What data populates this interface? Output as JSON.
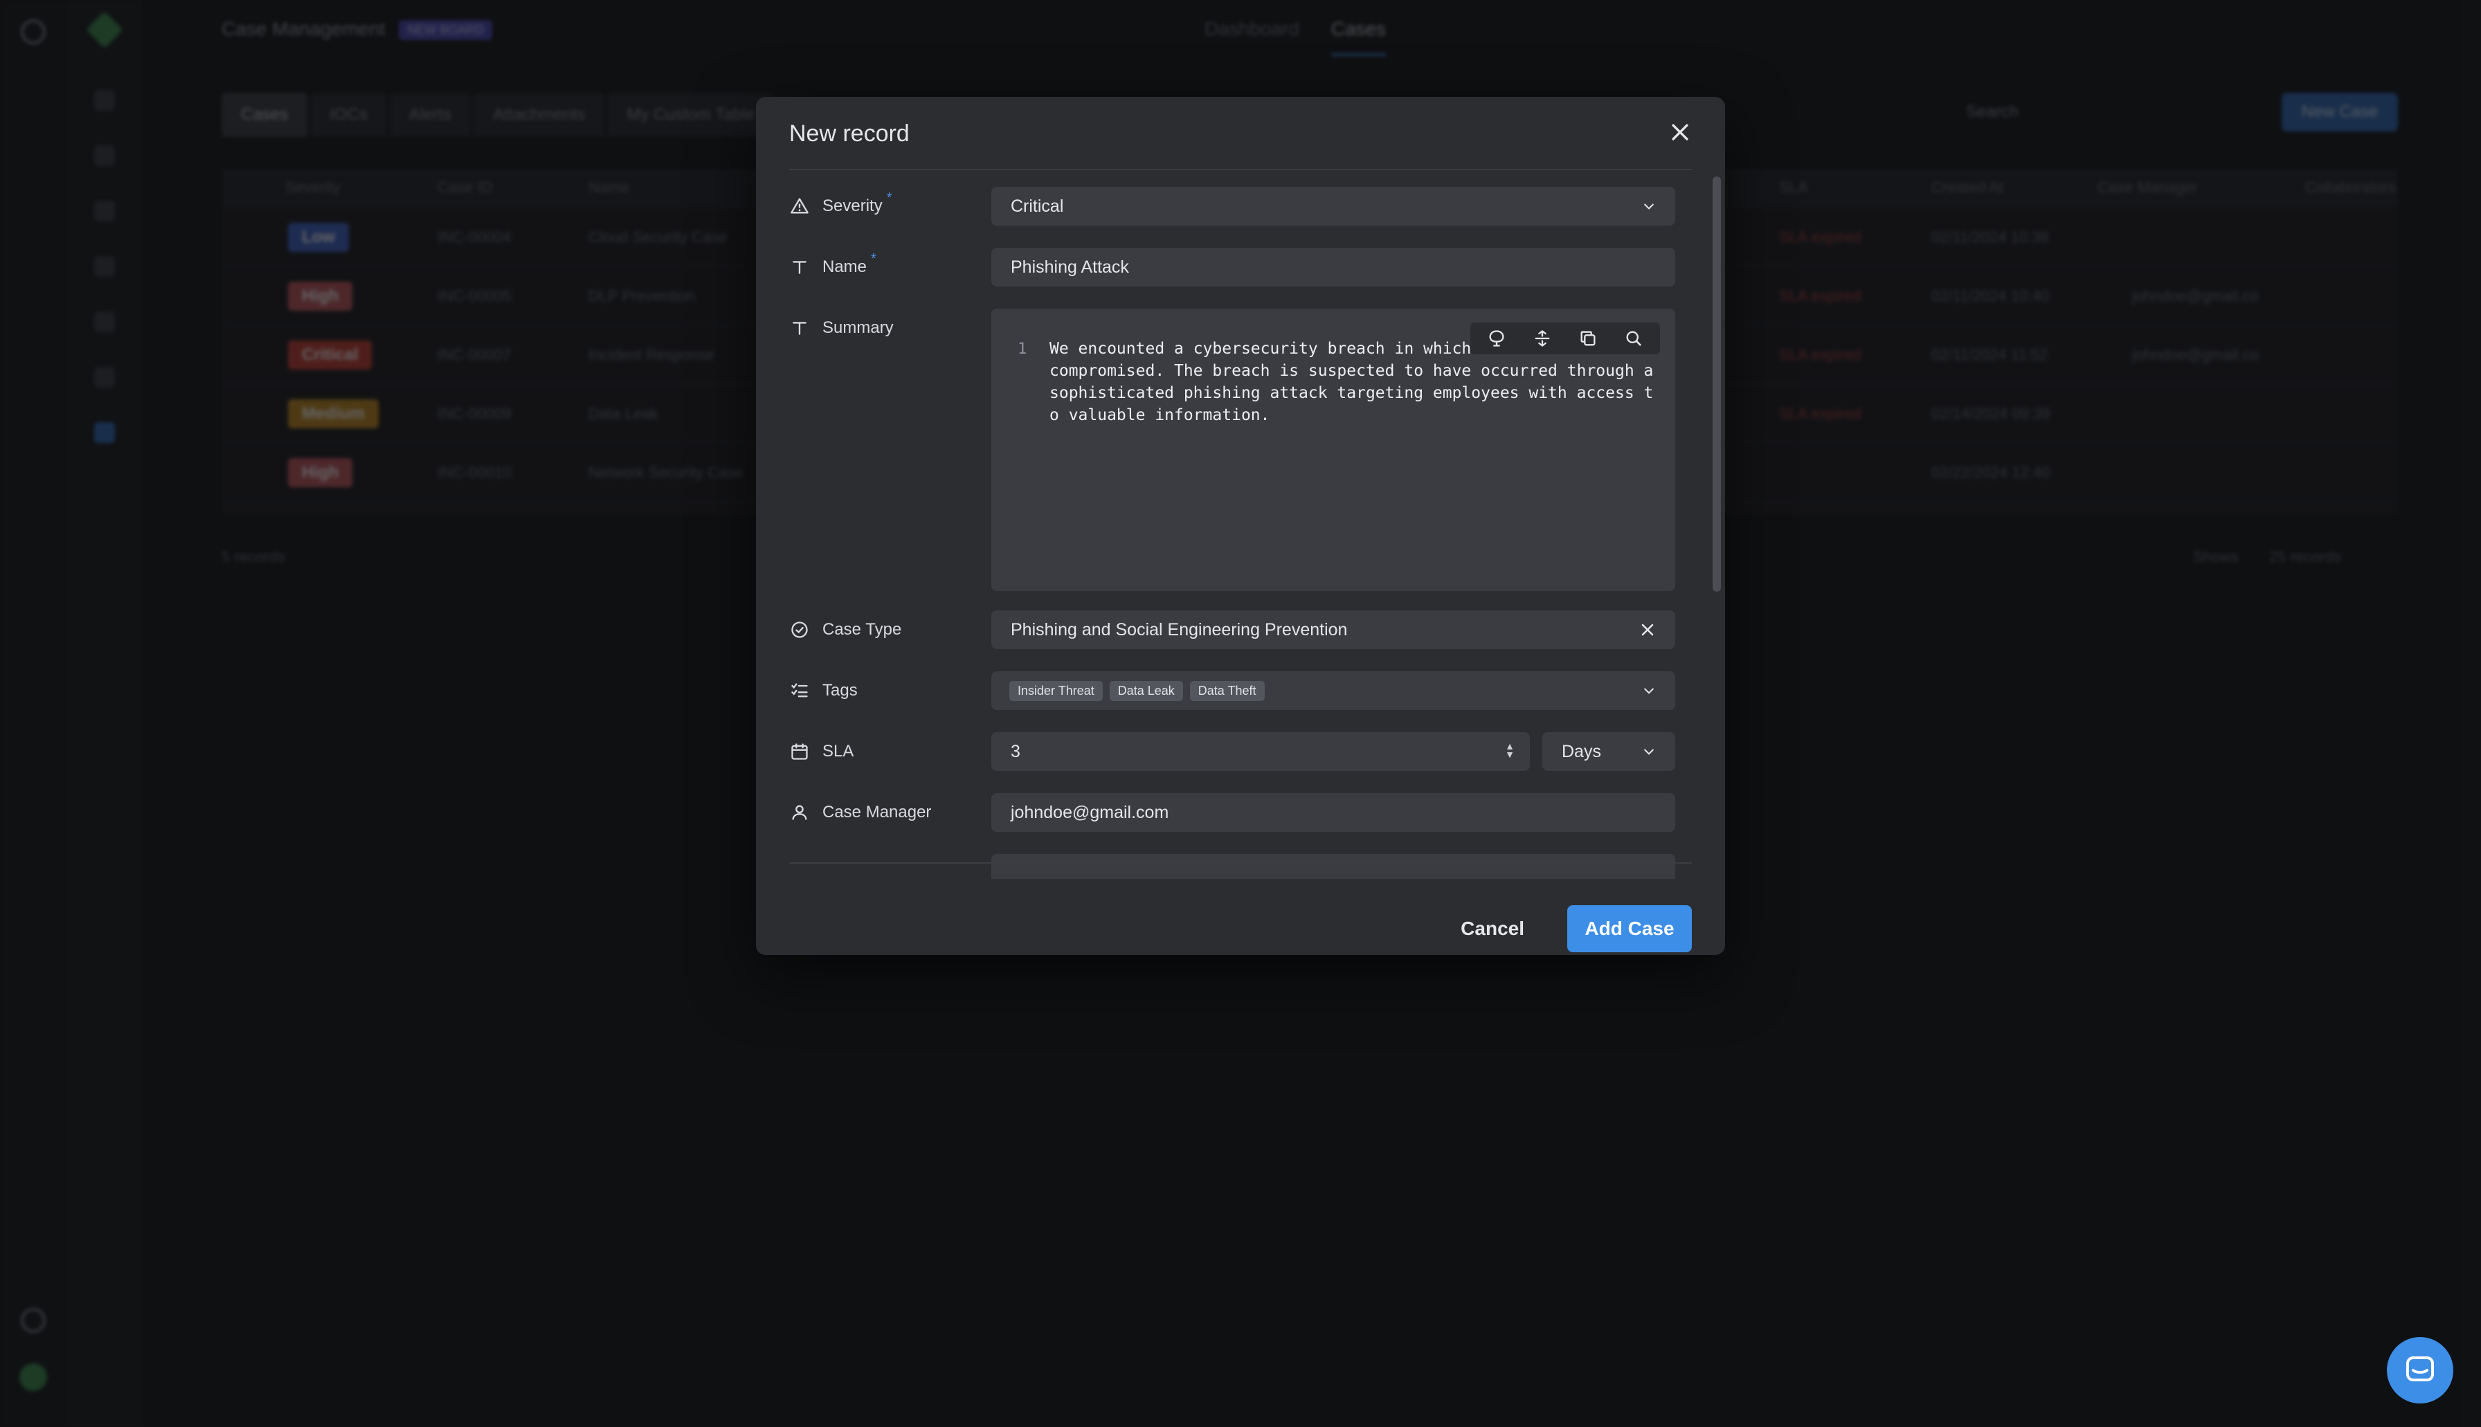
{
  "background": {
    "app_title": "Case Management",
    "beta_badge": "NEW BOARD",
    "nav": [
      "Dashboard",
      "Cases"
    ],
    "tabs": [
      "Cases",
      "IOCs",
      "Alerts",
      "Attachments",
      "My Custom Table"
    ],
    "search_placeholder": "Search",
    "new_case_label": "New Case",
    "columns": [
      "Severity",
      "Case ID",
      "Name",
      "SLA",
      "Created At",
      "Case Manager",
      "Collaborators"
    ],
    "rows": [
      {
        "severity": "Low",
        "color": "#3f63c9",
        "id": "INC-00004",
        "name": "Cloud Security Case",
        "sla": "SLA expired",
        "created": "02/11/2024 10:38",
        "manager": ""
      },
      {
        "severity": "High",
        "color": "#c2565b",
        "id": "INC-00005",
        "name": "DLP Prevention",
        "sla": "SLA expired",
        "created": "02/11/2024 10:40",
        "manager": "johndoe@gmail.co"
      },
      {
        "severity": "Critical",
        "color": "#c63d32",
        "id": "INC-00007",
        "name": "Incident Response",
        "sla": "SLA expired",
        "created": "02/11/2024 11:52",
        "manager": "johndoe@gmail.co"
      },
      {
        "severity": "Medium",
        "color": "#c48a1c",
        "id": "INC-00009",
        "name": "Data Leak",
        "sla": "SLA expired",
        "created": "02/14/2024 09:39",
        "manager": ""
      },
      {
        "severity": "High",
        "color": "#c2565b",
        "id": "INC-00010",
        "name": "Network Security Case",
        "sla": "",
        "created": "02/22/2024 12:40",
        "manager": ""
      }
    ],
    "records_count": "5 records",
    "shows_label": "Shows",
    "page_size": "25 records"
  },
  "modal": {
    "title": "New record",
    "fields": {
      "severity": {
        "label": "Severity",
        "value": "Critical",
        "required": "*"
      },
      "name": {
        "label": "Name",
        "value": "Phishing Attack",
        "required": "*"
      },
      "summary": {
        "label": "Summary",
        "line_number": "1",
        "text": "We encounted a cybersecurity breach in which sensitive data was compromised. The breach is suspected to have occurred through a sophisticated phishing attack targeting employees with access to valuable information."
      },
      "case_type": {
        "label": "Case Type",
        "value": "Phishing and Social Engineering Prevention"
      },
      "tags": {
        "label": "Tags",
        "values": [
          "Insider Threat",
          "Data Leak",
          "Data Theft"
        ]
      },
      "sla": {
        "label": "SLA",
        "value": "3",
        "unit": "Days"
      },
      "case_manager": {
        "label": "Case Manager",
        "value": "johndoe@gmail.com"
      }
    },
    "cancel_label": "Cancel",
    "submit_label": "Add Case"
  }
}
